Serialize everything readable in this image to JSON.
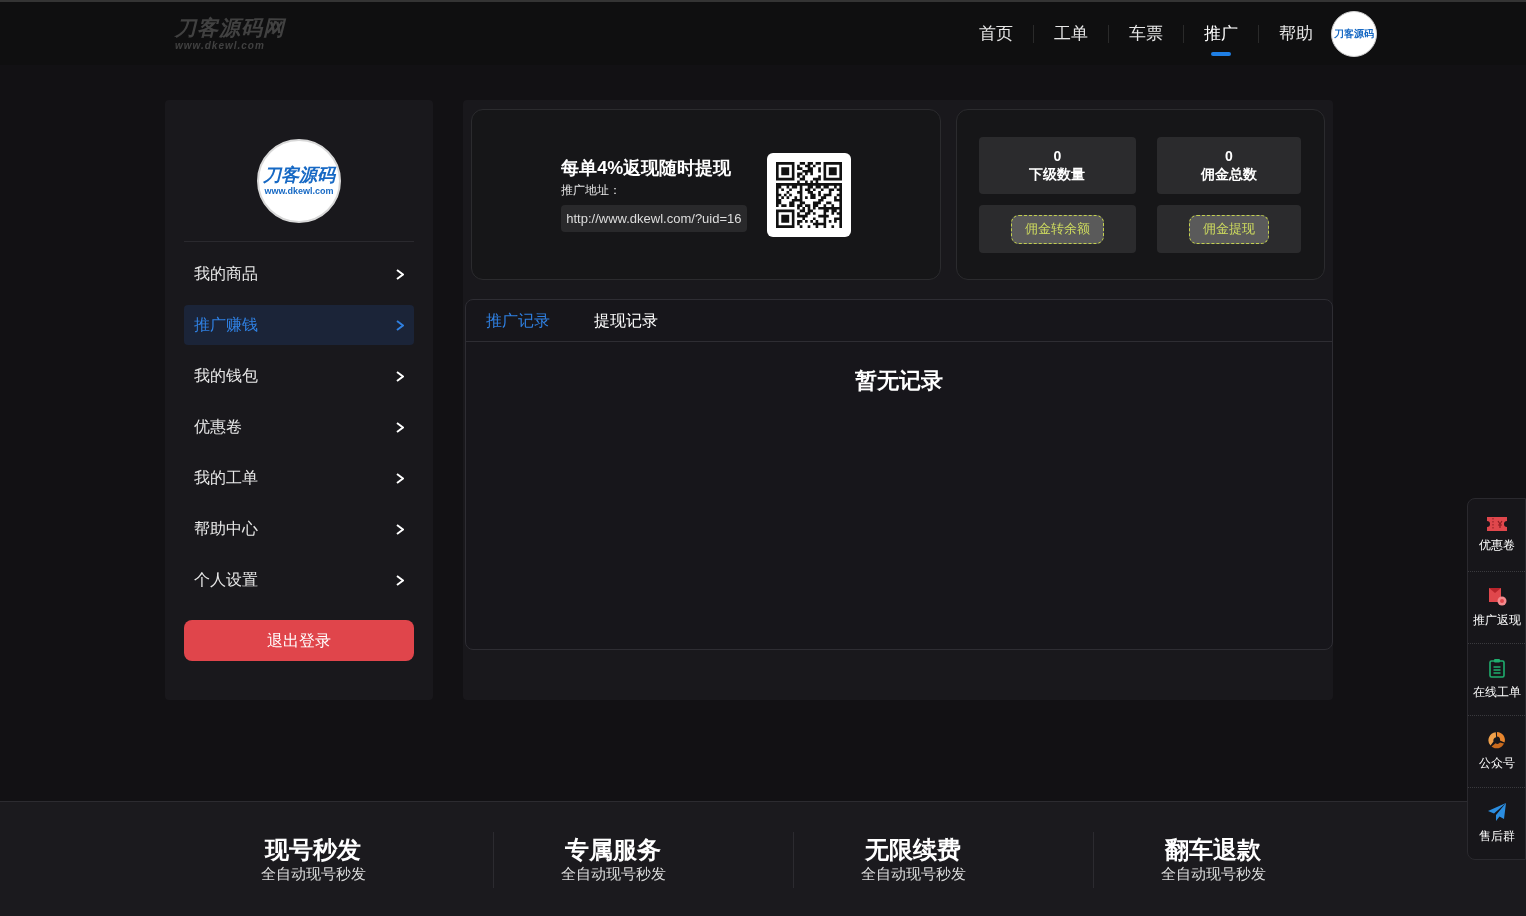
{
  "header": {
    "logo": {
      "title": "刀客源码网",
      "subtitle": "www.dkewl.com"
    },
    "nav": [
      {
        "label": "首页",
        "selected": false
      },
      {
        "label": "工单",
        "selected": false
      },
      {
        "label": "车票",
        "selected": false
      },
      {
        "label": "推广",
        "selected": true
      },
      {
        "label": "帮助",
        "selected": false
      }
    ],
    "avatar": {
      "text": "刀客源码"
    }
  },
  "sidebar": {
    "logo": {
      "title": "刀客源码",
      "subtitle": "www.dkewl.com"
    },
    "items": [
      {
        "label": "我的商品",
        "selected": false
      },
      {
        "label": "推广赚钱",
        "selected": true
      },
      {
        "label": "我的钱包",
        "selected": false
      },
      {
        "label": "优惠卷",
        "selected": false
      },
      {
        "label": "我的工单",
        "selected": false
      },
      {
        "label": "帮助中心",
        "selected": false
      },
      {
        "label": "个人设置",
        "selected": false
      }
    ],
    "logout_button": "退出登录"
  },
  "promo": {
    "headline": "每单4%返现随时提现",
    "link_label": "推广地址：",
    "link": "http://www.dkewl.com/?uid=16"
  },
  "stats": [
    {
      "value": "0",
      "label": "下级数量"
    },
    {
      "value": "0",
      "label": "佣金总数"
    }
  ],
  "actions": [
    "佣金转余额",
    "佣金提现"
  ],
  "records": {
    "tabs": [
      {
        "label": "推广记录",
        "selected": true
      },
      {
        "label": "提现记录",
        "selected": false
      }
    ],
    "empty_text": "暂无记录"
  },
  "footer": [
    {
      "title": "现号秒发",
      "subtitle": "全自动现号秒发"
    },
    {
      "title": "专属服务",
      "subtitle": "全自动现号秒发"
    },
    {
      "title": "无限续费",
      "subtitle": "全自动现号秒发"
    },
    {
      "title": "翻车退款",
      "subtitle": "全自动现号秒发"
    }
  ],
  "float_menu": [
    {
      "label": "优惠卷"
    },
    {
      "label": "推广返现"
    },
    {
      "label": "在线工单"
    },
    {
      "label": "公众号"
    },
    {
      "label": "售后群"
    }
  ]
}
